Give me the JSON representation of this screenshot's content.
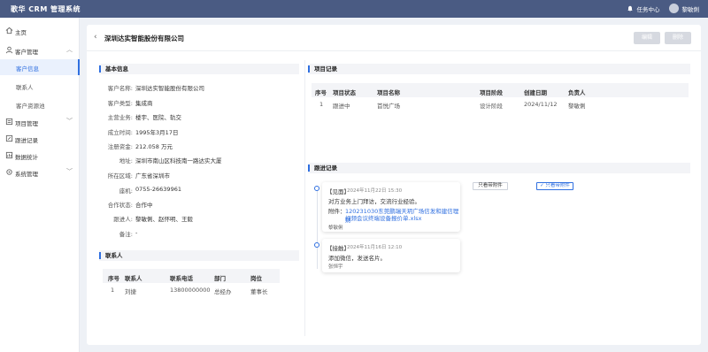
{
  "app": {
    "title": "歌华 CRM 管理系统"
  },
  "topbar": {
    "task_center": "任务中心",
    "user": "黎敏俐"
  },
  "sidebar": {
    "items": [
      {
        "label": "主页"
      },
      {
        "label": "客户管理"
      },
      {
        "label": "客户信息"
      },
      {
        "label": "联系人"
      },
      {
        "label": "客户资源池"
      },
      {
        "label": "项目管理"
      },
      {
        "label": "跟进记录"
      },
      {
        "label": "数据统计"
      },
      {
        "label": "系统管理"
      }
    ]
  },
  "page": {
    "title": "深圳达实智能股份有限公司",
    "edit": "编辑",
    "delete": "删除"
  },
  "basic": {
    "title": "基本信息",
    "rows": [
      {
        "label": "客户名称:",
        "value": "深圳达实智能股份有限公司"
      },
      {
        "label": "客户类型:",
        "value": "集成商"
      },
      {
        "label": "主营业务:",
        "value": "楼宇、医院、轨交"
      },
      {
        "label": "成立时间:",
        "value": "1995年3月17日"
      },
      {
        "label": "注册资金:",
        "value": "212.058 万元"
      },
      {
        "label": "地址:",
        "value": "深圳市南山区科技南一路达实大厦"
      },
      {
        "label": "所在区域:",
        "value": "广东省深圳市"
      },
      {
        "label": "座机:",
        "value": "0755-26639961"
      },
      {
        "label": "合作状态:",
        "value": "合作中"
      },
      {
        "label": "跟进人:",
        "value": "黎敏俐、赵怀明、王毅"
      },
      {
        "label": "备注:",
        "value": "-"
      }
    ]
  },
  "contacts": {
    "title": "联系人",
    "headers": [
      "序号",
      "联系人",
      "联系电话",
      "部门",
      "岗位"
    ],
    "rows": [
      [
        "1",
        "刘捷",
        "13800000000",
        "总经办",
        "董事长"
      ]
    ]
  },
  "projects": {
    "title": "项目记录",
    "headers": [
      "序号",
      "项目状态",
      "项目名称",
      "项目阶段",
      "创建日期",
      "负责人"
    ],
    "rows": [
      [
        "1",
        "跟进中",
        "首悦广场",
        "设计阶段",
        "2024/11/12",
        "黎敏俐"
      ]
    ]
  },
  "followups": {
    "title": "跟进记录",
    "filter_all": "只看带附件",
    "filter_active": "✓ 只看带附件",
    "items": [
      {
        "type": "【见面】",
        "time": "2024年11月22日 15:30",
        "content": "对方业务上门拜访，交流行业经验。",
        "attach_label": "附件：",
        "attach": "120231030东莞鹏瑞天玥广场信发和建筑信发会议终端设备报价单.xlsx",
        "attach_line2": "视频会议终端设备报价单.xlsx",
        "attach_line1": "120231030东莞鹏瑞天玥广场信发和建信理财",
        "person": "黎敏俐"
      },
      {
        "type": "【接触】",
        "time": "2024年11月16日 12:10",
        "content": "添加微信，发送名片。",
        "person": "张恒宇"
      }
    ]
  }
}
